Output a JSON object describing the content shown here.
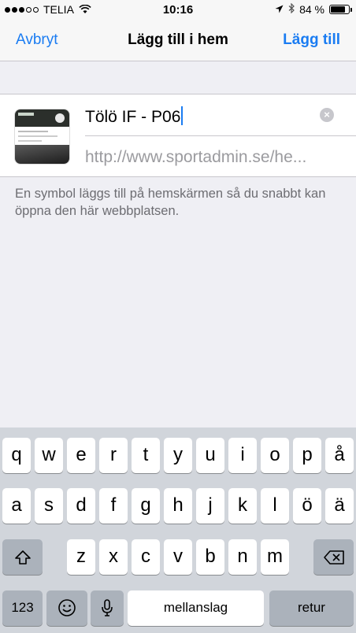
{
  "status_bar": {
    "carrier": "TELIA",
    "time": "10:16",
    "battery": "84 %"
  },
  "nav": {
    "cancel": "Avbryt",
    "title": "Lägg till i hem",
    "add": "Lägg till"
  },
  "form": {
    "title_value": "Tölö IF - P06",
    "url": "http://www.sportadmin.se/he..."
  },
  "info": "En symbol läggs till på hemskärmen så du snabbt kan öppna den här webbplatsen.",
  "keyboard": {
    "row1": [
      "q",
      "w",
      "e",
      "r",
      "t",
      "y",
      "u",
      "i",
      "o",
      "p",
      "å"
    ],
    "row2": [
      "a",
      "s",
      "d",
      "f",
      "g",
      "h",
      "j",
      "k",
      "l",
      "ö",
      "ä"
    ],
    "row3": [
      "z",
      "x",
      "c",
      "v",
      "b",
      "n",
      "m"
    ],
    "numbers_label": "123",
    "space_label": "mellanslag",
    "return_label": "retur"
  }
}
